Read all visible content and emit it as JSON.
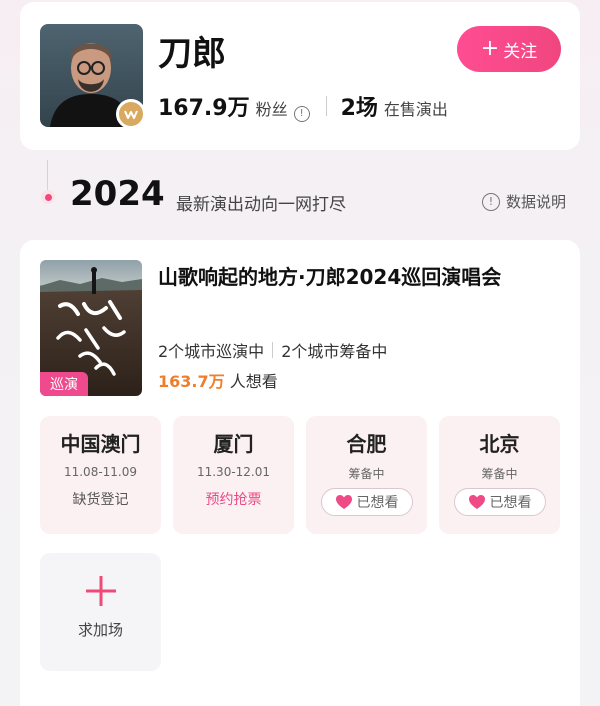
{
  "artist": {
    "name": "刀郎",
    "fans_count": "167.9万",
    "fans_label": "粉丝",
    "shows_count": "2场",
    "shows_label": "在售演出",
    "follow_label": "关注"
  },
  "timeline": {
    "year": "2024",
    "subtitle": "最新演出动向一网打尽",
    "data_note": "数据说明"
  },
  "tour": {
    "title": "山歌响起的地方·刀郎2024巡回演唱会",
    "poster_tag": "巡演",
    "touring_cities": "2个城市巡演中",
    "preparing_cities": "2个城市筹备中",
    "want_count": "163.7万",
    "want_label": "人想看",
    "cities": [
      {
        "name": "中国澳门",
        "date": "11.08-11.09",
        "action": "缺货登记"
      },
      {
        "name": "厦门",
        "date": "11.30-12.01",
        "action": "预约抢票"
      },
      {
        "name": "合肥",
        "status": "筹备中",
        "action": "已想看"
      },
      {
        "name": "北京",
        "status": "筹备中",
        "action": "已想看"
      }
    ],
    "add_show_label": "求加场"
  },
  "colors": {
    "accent_pink": "#ef4a7a",
    "want_orange": "#f07d2a",
    "badge_gold": "#d9a960"
  },
  "icons": [
    "verified-badge-icon",
    "info-icon",
    "plus-icon",
    "heart-icon"
  ]
}
